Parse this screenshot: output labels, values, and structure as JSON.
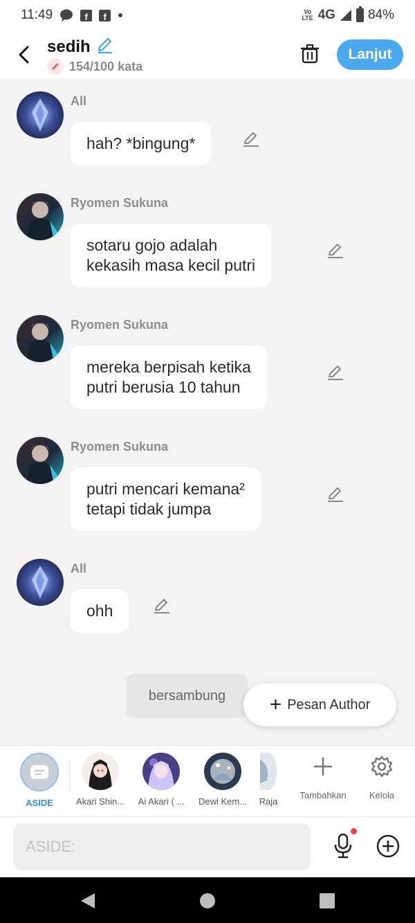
{
  "status_bar": {
    "time": "11:49",
    "network_label": "4G",
    "volte_label": "Vo LTE",
    "battery": "84%"
  },
  "header": {
    "title": "sedih",
    "word_count": "154/100 kata",
    "next_label": "Lanjut"
  },
  "messages": [
    {
      "sender": "All",
      "text": "hah? *bingung*",
      "avatar": "crystal"
    },
    {
      "sender": "Ryomen Sukuna",
      "text": "sotaru gojo adalah\nkekasih masa kecil putri",
      "avatar": "sukuna"
    },
    {
      "sender": "Ryomen Sukuna",
      "text": "mereka berpisah ketika\nputri berusia 10 tahun",
      "avatar": "sukuna"
    },
    {
      "sender": "Ryomen Sukuna",
      "text": "putri mencari kemana²\ntetapi tidak jumpa",
      "avatar": "sukuna"
    },
    {
      "sender": "All",
      "text": "ohh",
      "avatar": "crystal"
    }
  ],
  "continue_chip": "bersambung",
  "author_button": "Pesan Author",
  "characters": {
    "aside": "ASIDE",
    "items": [
      {
        "label": "Akari Shin..."
      },
      {
        "label": "Ai Akari ( ..."
      },
      {
        "label": "Dewi Kem..."
      },
      {
        "label": "Raja"
      }
    ],
    "add_label": "Tambahkan",
    "manage_label": "Kelola"
  },
  "input": {
    "placeholder": "ASIDE:"
  },
  "colors": {
    "accent": "#4aa8ef",
    "aside_label": "#3a8fe0",
    "notification_dot": "#f0404b"
  }
}
